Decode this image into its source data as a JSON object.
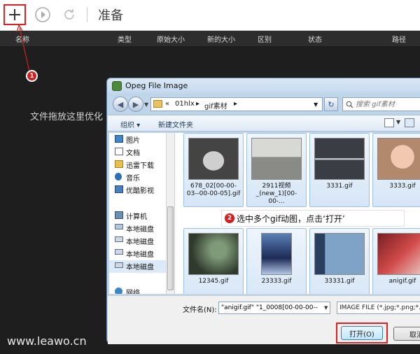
{
  "toolbar": {
    "status_text": "准备"
  },
  "columns": [
    "名称",
    "类型",
    "原始大小",
    "新的大小",
    "区别",
    "状态",
    "路径"
  ],
  "drop_hint": "文件拖放这里优化",
  "markers": {
    "one": "1",
    "two": "2"
  },
  "watermark": "www.leawo.cn",
  "dialog": {
    "title": "Opeg File Image",
    "address": {
      "chevrons": "«",
      "crumbs": [
        "01hlx",
        "gif素材"
      ],
      "separator": "▸"
    },
    "search_placeholder": "搜索 gif素材",
    "commands": {
      "organize": "组织 ▾",
      "new_folder": "新建文件夹"
    },
    "nav_items": [
      {
        "label": "图片",
        "icon": "pictures-icon"
      },
      {
        "label": "文档",
        "icon": "documents-icon"
      },
      {
        "label": "迅雷下载",
        "icon": "download-icon"
      },
      {
        "label": "音乐",
        "icon": "music-icon"
      },
      {
        "label": "优酷影视",
        "icon": "video-icon"
      },
      {
        "label": "计算机",
        "icon": "computer-icon"
      },
      {
        "label": "本地磁盘",
        "icon": "disk-icon"
      },
      {
        "label": "本地磁盘",
        "icon": "disk-icon"
      },
      {
        "label": "本地磁盘",
        "icon": "disk-icon"
      },
      {
        "label": "本地磁盘",
        "icon": "disk-icon"
      },
      {
        "label": "网络",
        "icon": "network-icon"
      }
    ],
    "files": [
      {
        "name": "678_02[00-00-03--00-00-05].gif"
      },
      {
        "name": "2911视频_(new_1)[00-00-..."
      },
      {
        "name": "3331.gif"
      },
      {
        "name": "3333.gif"
      },
      {
        "name": "12345.gif"
      },
      {
        "name": "23333.gif"
      },
      {
        "name": "33331.gif"
      },
      {
        "name": "anigif.gif"
      }
    ],
    "callout": "选中多个gif动图，点击‘打开’",
    "filename_label": "文件名(N):",
    "filename_value": "\"anigif.gif\" \"1_0008[00-00-00--",
    "filetype": "IMAGE FILE (*.jpg;*.png;*.",
    "open_label": "打开(O)",
    "cancel_label": "取消"
  },
  "colors": {
    "accent_red": "#e02020",
    "dark_bg": "#1e1e1e",
    "dialog_frame": "#bfd5ea"
  }
}
